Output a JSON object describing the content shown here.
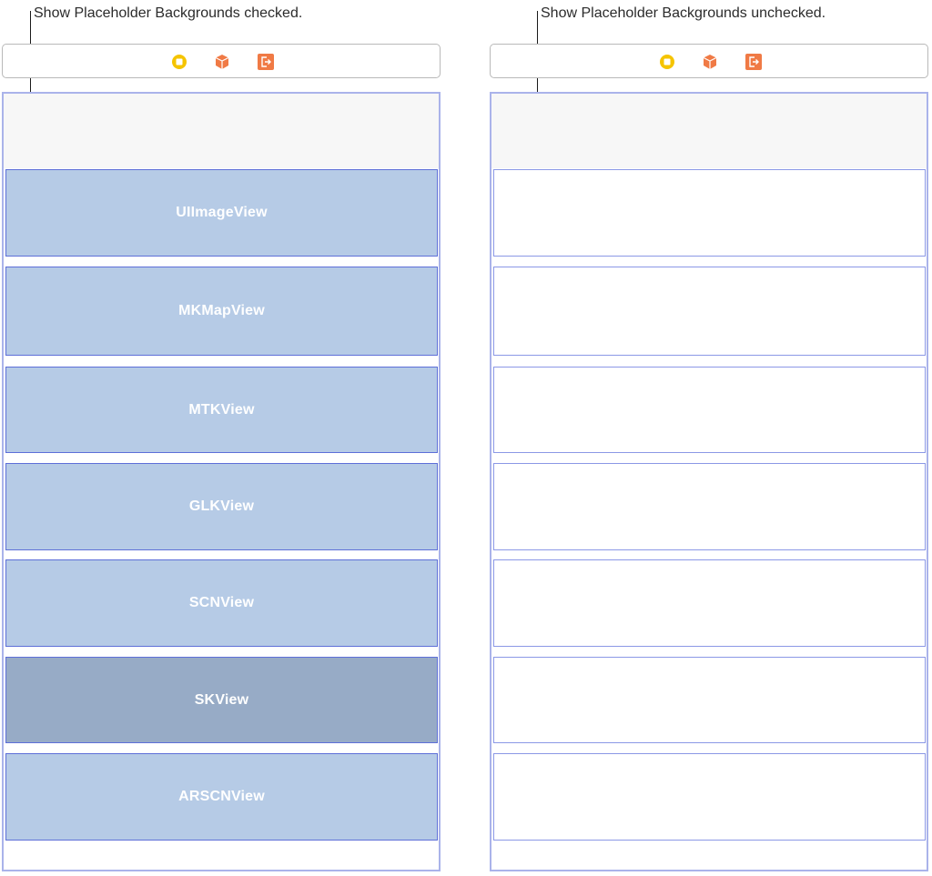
{
  "callouts": {
    "left": "Show Placeholder Backgrounds checked.",
    "right": "Show Placeholder Backgrounds unchecked."
  },
  "dock_icons": [
    "first-responder-icon",
    "exit-cube-icon",
    "exit-icon"
  ],
  "colors": {
    "view_fill": "#b6cbe6",
    "view_fill_selected": "#97abc6",
    "view_border": "#5d6fd8",
    "scene_border": "#aab3ea",
    "first_responder": "#f5c400",
    "cube": "#f07a45",
    "exit": "#f07a45"
  },
  "left_views": [
    "UIImageView",
    "MKMapView",
    "MTKView",
    "GLKView",
    "SCNView",
    "SKView",
    "ARSCNView"
  ],
  "selected_view": "SKView"
}
